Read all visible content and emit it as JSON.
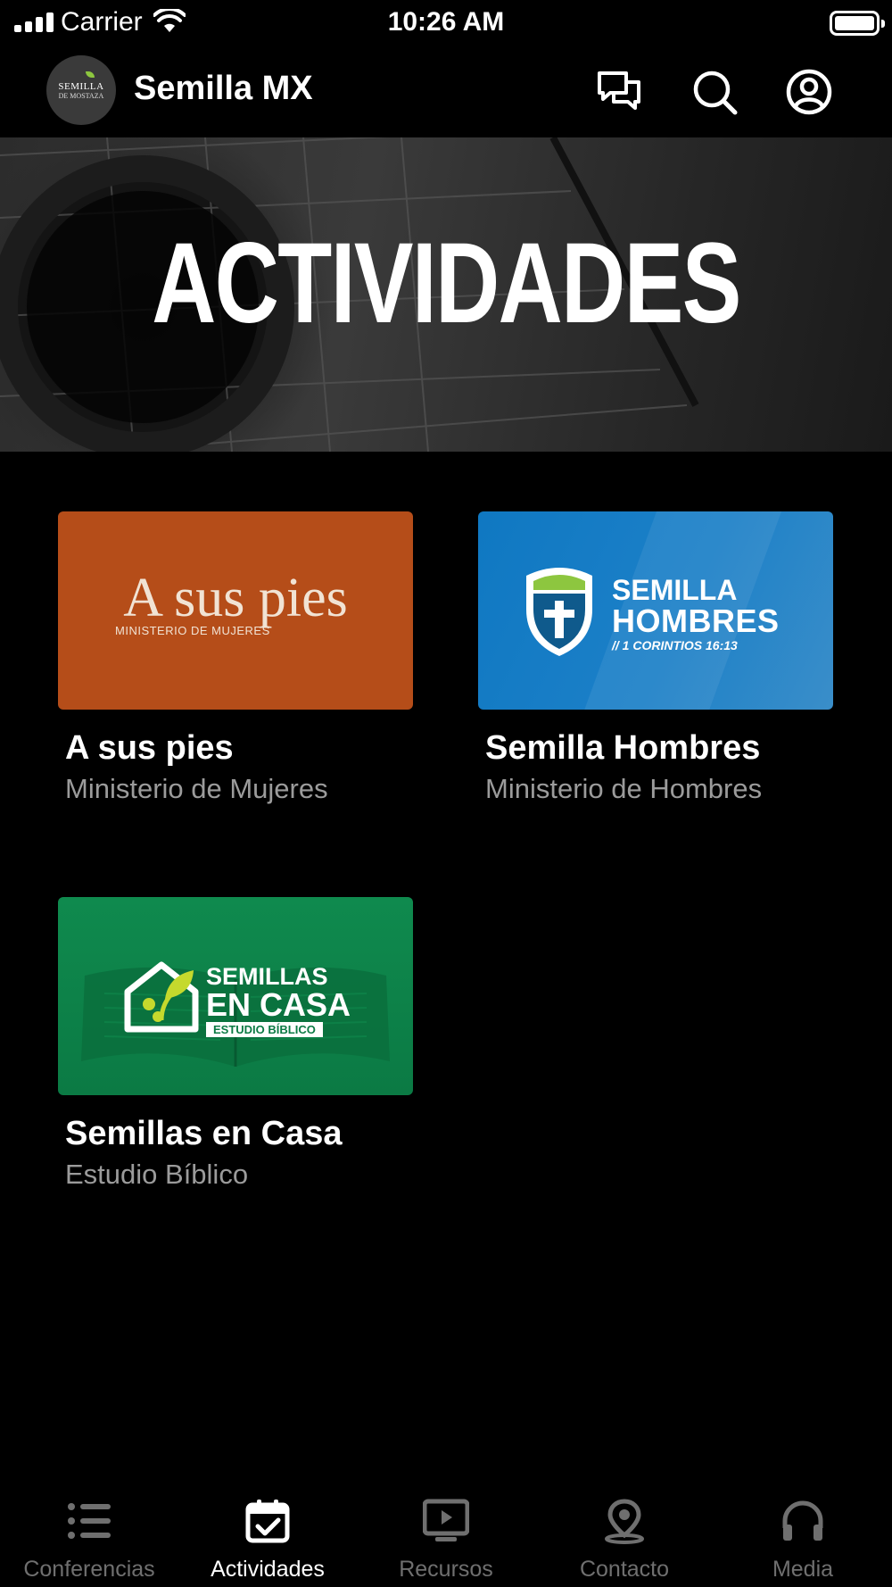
{
  "status_bar": {
    "carrier": "Carrier",
    "time": "10:26 AM"
  },
  "header": {
    "title": "Semilla MX",
    "logo_text_top": "SEMILLA",
    "logo_text_bottom": "DE MOSTAZA",
    "icons": [
      "chat-icon",
      "search-icon",
      "profile-icon"
    ]
  },
  "hero": {
    "title": "ACTIVIDADES"
  },
  "cards": [
    {
      "title": "A sus pies",
      "subtitle": "Ministerio de Mujeres",
      "logo_main": "A sus pies",
      "logo_sub": "MINISTERIO DE MUJERES"
    },
    {
      "title": "Semilla Hombres",
      "subtitle": "Ministerio de Hombres",
      "logo_line1": "SEMILLA",
      "logo_line2": "HOMBRES",
      "logo_line3": "// 1 CORINTIOS 16:13"
    },
    {
      "title": "Semillas en Casa",
      "subtitle": "Estudio Bíblico",
      "logo_line1": "SEMILLAS",
      "logo_line2": "EN CASA",
      "logo_line3": "ESTUDIO BÍBLICO"
    }
  ],
  "tabbar": {
    "active": "Actividades",
    "tabs": [
      {
        "label": "Conferencias",
        "icon": "list-icon"
      },
      {
        "label": "Actividades",
        "icon": "calendar-check-icon"
      },
      {
        "label": "Recursos",
        "icon": "tv-play-icon"
      },
      {
        "label": "Contacto",
        "icon": "location-pin-icon"
      },
      {
        "label": "Media",
        "icon": "headphones-icon"
      }
    ]
  },
  "colors": {
    "background": "#000000",
    "card_a_sus_pies": "#b54d19",
    "card_hombres": "#1c80c8",
    "card_casa": "#0b7a44",
    "subtitle_gray": "#9b9b9b",
    "tab_inactive": "#6f6f6f"
  }
}
